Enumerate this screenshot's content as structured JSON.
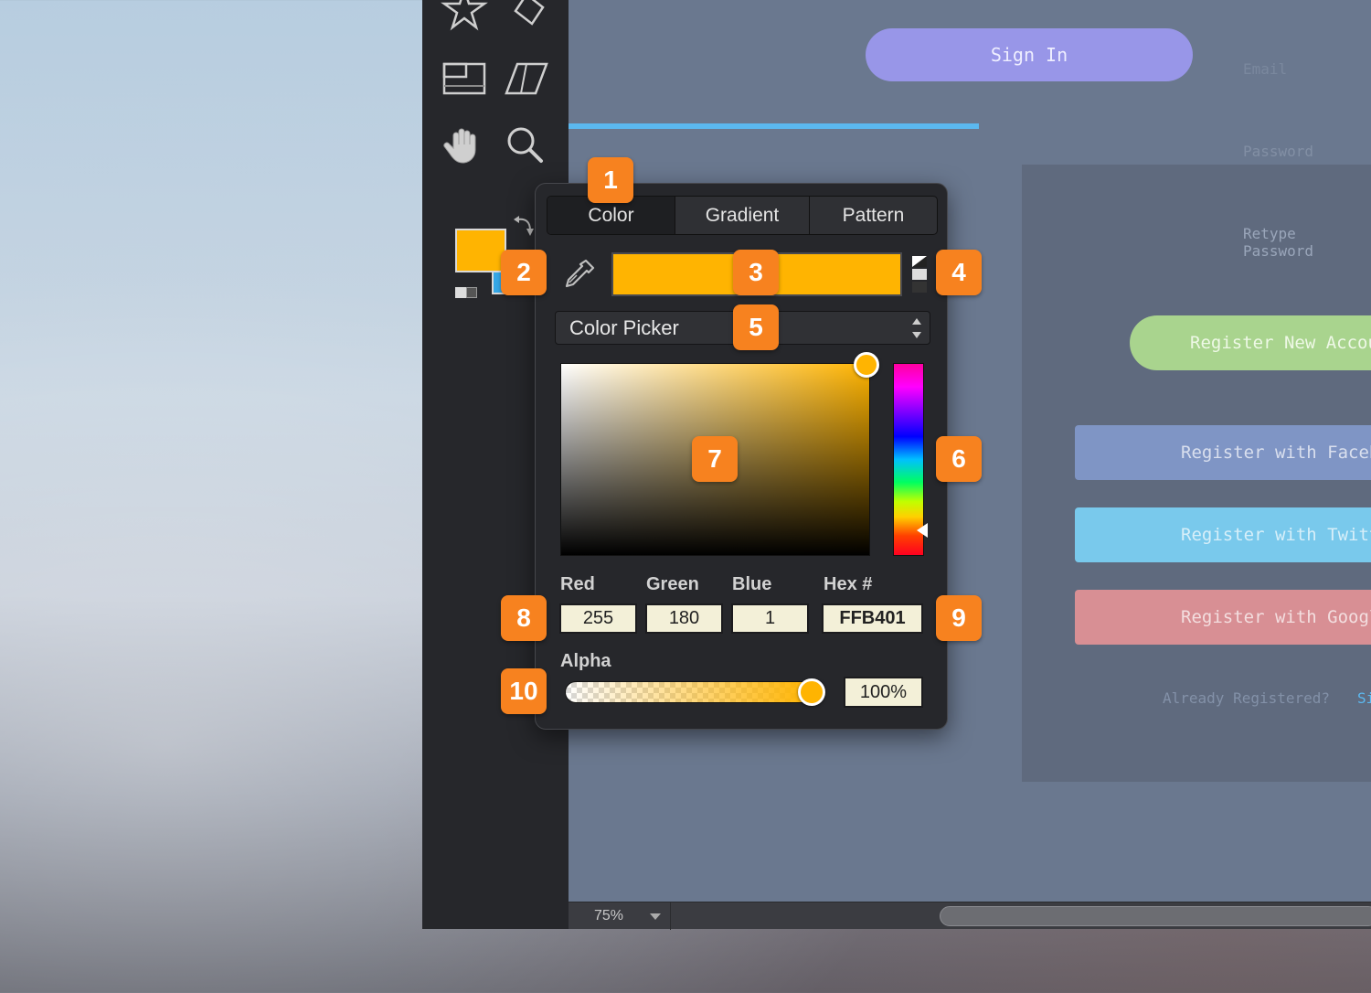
{
  "colors": {
    "primary": "#FFB401",
    "accent_orange": "#F7821F",
    "secondary": "#35A7E6",
    "panel": "#26272B"
  },
  "toolbar": {
    "tools": [
      {
        "name": "star-tool-icon",
        "label": "Star"
      },
      {
        "name": "polygon-tool-icon",
        "label": "Polygon"
      },
      {
        "name": "frame-tool-icon",
        "label": "Frame"
      },
      {
        "name": "transform-tool-icon",
        "label": "Transform"
      },
      {
        "name": "hand-tool-icon",
        "label": "Hand"
      },
      {
        "name": "zoom-tool-icon",
        "label": "Zoom"
      }
    ],
    "foreground_color": "#FFB401",
    "background_color": "#35A7E6"
  },
  "statusbar": {
    "zoom": "75%"
  },
  "canvas": {
    "signin": "Sign In",
    "email_placeholder": "Email",
    "password_placeholder": "Password",
    "retype_password_placeholder": "Retype Password",
    "register_new": "Register New Account",
    "register_facebook": "Register with Facebook",
    "register_twitter": "Register with Twitter",
    "register_google": "Register with Google",
    "already_registered": "Already Registered?",
    "signin_link": "Sign In"
  },
  "popover": {
    "tabs": [
      "Color",
      "Gradient",
      "Pattern"
    ],
    "active_tab": "Color",
    "picker_mode": "Color Picker",
    "channels": {
      "red_label": "Red",
      "red": "255",
      "green_label": "Green",
      "green": "180",
      "blue_label": "Blue",
      "blue": "1",
      "hex_label": "Hex #",
      "hex": "FFB401"
    },
    "alpha_label": "Alpha",
    "alpha": "100%"
  },
  "callouts": [
    "1",
    "2",
    "3",
    "4",
    "5",
    "6",
    "7",
    "8",
    "9",
    "10"
  ]
}
